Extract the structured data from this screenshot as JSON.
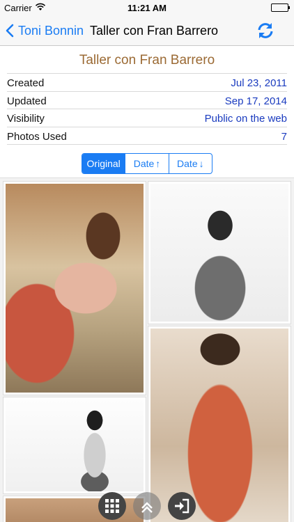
{
  "status_bar": {
    "carrier": "Carrier",
    "time": "11:21 AM"
  },
  "nav": {
    "back_label": "Toni Bonnin",
    "title": "Taller con Fran Barrero"
  },
  "album": {
    "title": "Taller con Fran Barrero",
    "rows": [
      {
        "label": "Created",
        "value": "Jul 23, 2011"
      },
      {
        "label": "Updated",
        "value": "Sep 17, 2014"
      },
      {
        "label": "Visibility",
        "value": "Public on the web"
      },
      {
        "label": "Photos Used",
        "value": "7"
      }
    ]
  },
  "sort": {
    "options": [
      "Original",
      "Date",
      "Date"
    ],
    "arrows": [
      "",
      "↑",
      "↓"
    ],
    "selected": "Original"
  },
  "colors": {
    "accent": "#1a7cf3",
    "album_title": "#9b6a34",
    "value_text": "#1a3bbf"
  },
  "icons": {
    "back": "chevron-left-icon",
    "refresh": "refresh-icon",
    "grid": "grid-icon",
    "scroll_top": "chevron-up-icon",
    "exit": "sign-out-icon"
  }
}
